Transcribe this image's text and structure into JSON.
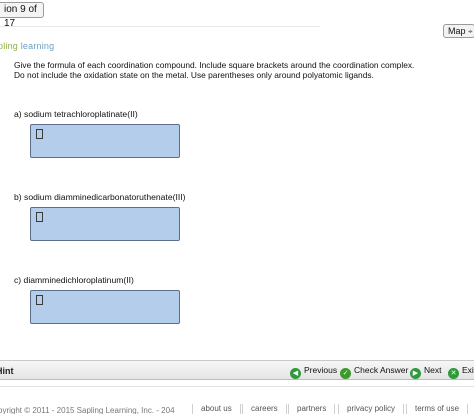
{
  "header": {
    "question_counter": "ion 9 of 17",
    "map_label": "Map",
    "brand_part1": "pling ",
    "brand_part2": "learning"
  },
  "question": {
    "instructions_line1": "Give the formula of each coordination compound. Include square brackets around the coordination complex.",
    "instructions_line2": "Do not include the oxidation state on the metal. Use parentheses only around polyatomic ligands.",
    "parts": [
      {
        "label": "a) sodium tetrachloroplatinate(II)",
        "answer": ""
      },
      {
        "label": "b) sodium diamminedicarbonatoruthenate(III)",
        "answer": ""
      },
      {
        "label": "c) diamminedichloroplatinum(II)",
        "answer": ""
      }
    ]
  },
  "nav": {
    "hint_label": "Hint",
    "previous_label": "Previous",
    "check_answer_label": "Check Answer",
    "next_label": "Next",
    "exit_label": "Exit"
  },
  "footer": {
    "copyright": "pyright © 2011 - 2015 Sapling Learning, Inc. - 204",
    "links": [
      "about us",
      "careers",
      "partners",
      "privacy policy",
      "terms of use"
    ]
  }
}
